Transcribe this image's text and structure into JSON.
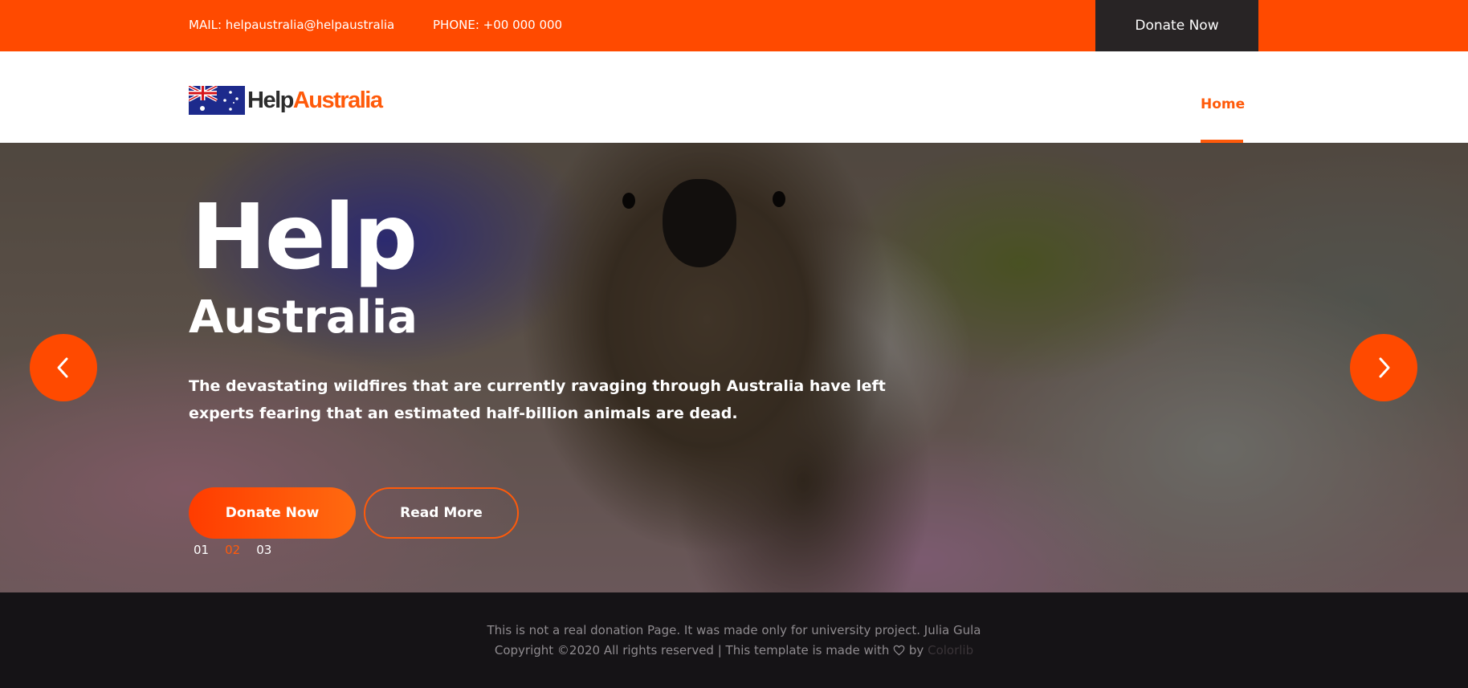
{
  "topbar": {
    "mail": "MAIL: helpaustralia@helpaustralia",
    "phone": "PHONE: +00 000 000",
    "donate_label": "Donate Now"
  },
  "header": {
    "logo": {
      "part1": "Help",
      "part2": "Australia",
      "flag_icon": "australia-flag-icon"
    },
    "nav": [
      {
        "label": "Home",
        "active": true
      }
    ]
  },
  "hero": {
    "title": "Help",
    "subtitle": "Australia",
    "text": "The devastating wildfires that are currently ravaging through Australia have left experts fearing that an estimated half-billion animals are dead.",
    "primary_button": "Donate Now",
    "secondary_button": "Read More",
    "slides": [
      "01",
      "02",
      "03"
    ],
    "active_slide": 1,
    "prev_icon": "chevron-left-icon",
    "next_icon": "chevron-right-icon"
  },
  "footer": {
    "line1": "This is not a real donation Page. It was made only for university project. Julia Gula",
    "line2_prefix": "Copyright ©2020 All rights reserved | This template is made with",
    "line2_by": "by",
    "brand": "Colorlib"
  },
  "colors": {
    "accent": "#ff4a00",
    "dark": "#282425",
    "footer_bg": "#151316"
  }
}
